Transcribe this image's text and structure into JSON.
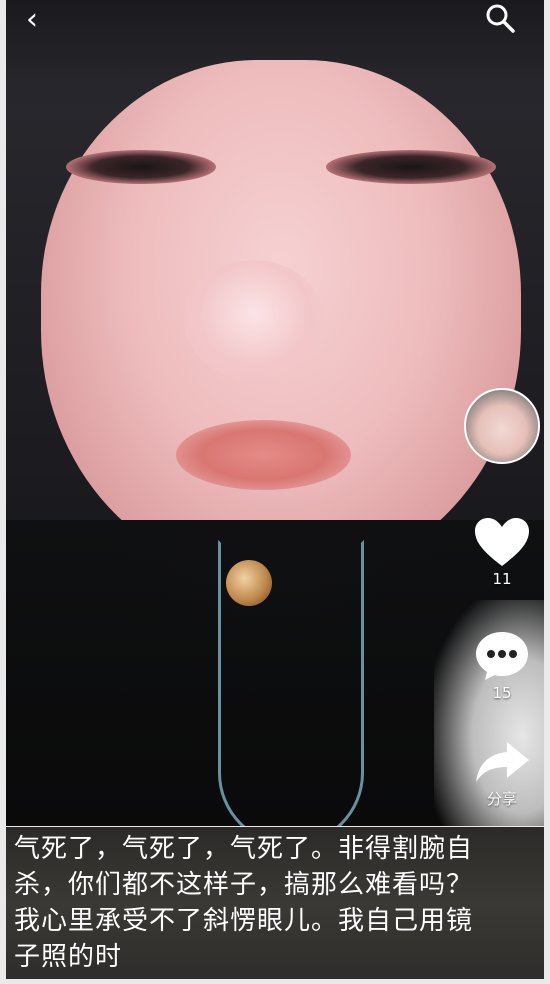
{
  "header": {
    "back_icon": "chevron-left-icon",
    "back_glyph": "‹",
    "search_icon": "search-icon"
  },
  "right_rail": {
    "likes": "11",
    "comments": "15",
    "share_label": "分享"
  },
  "caption": {
    "lines": [
      "气死了，气死了，气死了。非得割腕自",
      "杀，你们都不这样子，搞那么难看吗？",
      "我心里承受不了斜愣眼儿。我自己用镜",
      "子照的时"
    ]
  },
  "colors": {
    "icon": "#ffffff",
    "caption_bg": "#2f2d2b"
  }
}
